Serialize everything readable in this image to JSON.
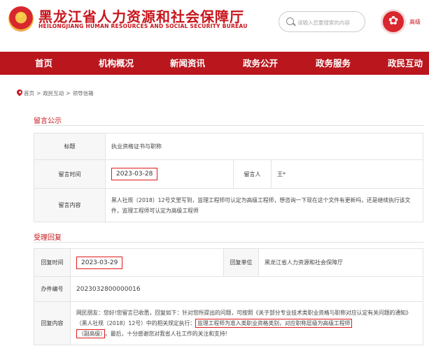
{
  "header": {
    "site_title": "黑龙江省人力资源和社会保障厅",
    "site_subtitle": "HEILONGJIANG HUMAN RESOURCES AND SOCIAL SECURITY BUREAU",
    "search_placeholder": "请输入您要搜索的内容",
    "top_link": "高级"
  },
  "nav": {
    "items": [
      "首页",
      "机构概况",
      "新闻资讯",
      "政务公开",
      "政务服务",
      "政民互动"
    ]
  },
  "breadcrumb": [
    "首页",
    "政民互动",
    "领导信箱"
  ],
  "breadcrumb_sep": ">",
  "message": {
    "section_title": "留言公示",
    "title_label": "标题",
    "title_value": "执业资格证书与职称",
    "time_label": "留言时间",
    "time_value": "2023-03-28",
    "author_label": "留言人",
    "author_value": "王*",
    "content_label": "留言内容",
    "content_value": "黑人社规（2018）12号文里写到，监理工程师可认定为高级工程师，想咨询一下现在这个文件有更新吗，还是继续执行该文件，监理工程师可认定为高级工程师"
  },
  "reply": {
    "section_title": "受理回复",
    "time_label": "回复时间",
    "time_value": "2023-03-29",
    "unit_label": "回复单位",
    "unit_value": "黑龙江省人力资源和社会保障厅",
    "number_label": "办件编号",
    "number_value": "2023032800000016",
    "content_label": "回复内容",
    "content_part1": "网民朋友：您好!您留言已收悉，回复如下：针对您所提出的问题，可按照《关于部分专业技术类职业资格与职称对应认定有关问题的通知》（黑人社规〔2018〕12号）中的相关规定执行：",
    "content_highlight1": "监理工程师为准入类职业资格类别，对应职称层级为高级工程师",
    "content_highlight2": "（副高级）",
    "content_part2": "。最后，十分感谢您对我省人社工作的关注和支持!"
  }
}
